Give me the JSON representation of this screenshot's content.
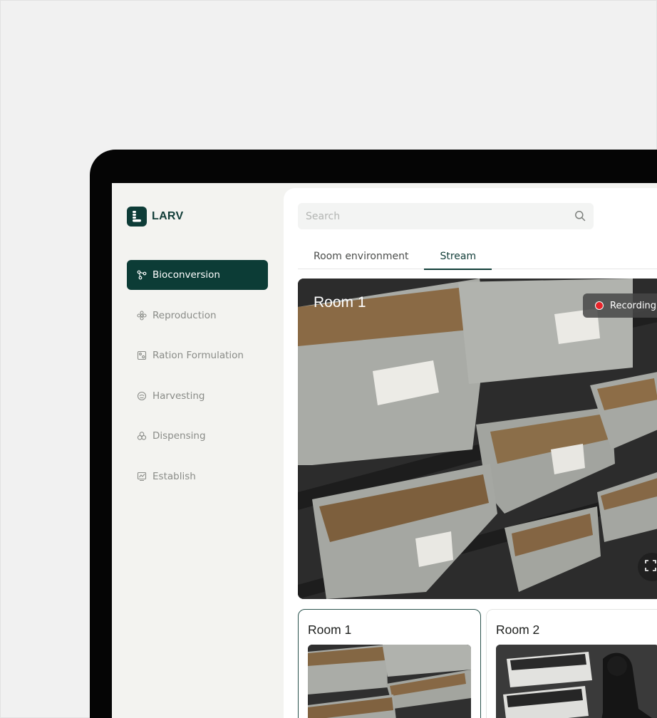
{
  "brand": {
    "name": "LARV",
    "logo_icon": "larva-logo-icon"
  },
  "sidebar": {
    "items": [
      {
        "label": "Bioconversion",
        "icon": "molecule-icon",
        "active": true
      },
      {
        "label": "Reproduction",
        "icon": "flower-icon",
        "active": false
      },
      {
        "label": "Ration Formulation",
        "icon": "recipe-icon",
        "active": false
      },
      {
        "label": "Harvesting",
        "icon": "harvest-icon",
        "active": false
      },
      {
        "label": "Dispensing",
        "icon": "dispense-icon",
        "active": false
      },
      {
        "label": "Establish",
        "icon": "chart-icon",
        "active": false
      }
    ]
  },
  "search": {
    "placeholder": "Search",
    "value": ""
  },
  "tabs": [
    {
      "label": "Room environment",
      "active": false
    },
    {
      "label": "Stream",
      "active": true
    }
  ],
  "stream": {
    "title": "Room 1",
    "recording_label": "Recording"
  },
  "rooms": [
    {
      "label": "Room 1",
      "selected": true
    },
    {
      "label": "Room 2",
      "selected": false
    }
  ],
  "colors": {
    "brand_dark": "#0c3c36",
    "recording_red": "#e8242a",
    "page_bg": "#f1f1f1",
    "sidebar_bg": "#f3f3f0"
  }
}
